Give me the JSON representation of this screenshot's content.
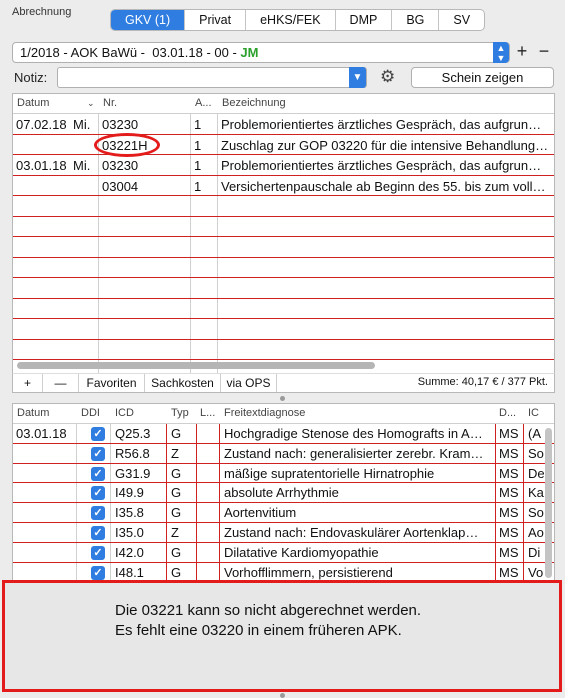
{
  "section_label": "Abrechnung",
  "tabs": [
    "GKV (1)",
    "Privat",
    "eHKS/FEK",
    "DMP",
    "BG",
    "SV"
  ],
  "selector": {
    "text": "1/2018 - AOK BaWü -  03.01.18 - 00 - ",
    "doctor": "JM"
  },
  "notiz": {
    "label": "Notiz:",
    "value": ""
  },
  "schein_button": "Schein zeigen",
  "services": {
    "headers": [
      "Datum",
      "Nr.",
      "A...",
      "Bezeichnung"
    ],
    "rows": [
      {
        "date": "07.02.18",
        "day": "Mi.",
        "nr": "03230",
        "a": "1",
        "desc": "Problemorientiertes ärztliches Gespräch, das aufgrun…"
      },
      {
        "date": "",
        "day": "",
        "nr": "03221H",
        "a": "1",
        "desc": "Zuschlag zur GOP 03220 für die intensive Behandlung…"
      },
      {
        "date": "03.01.18",
        "day": "Mi.",
        "nr": "03230",
        "a": "1",
        "desc": "Problemorientiertes ärztliches Gespräch, das aufgrun…"
      },
      {
        "date": "",
        "day": "",
        "nr": "03004",
        "a": "1",
        "desc": "Versichertenpauschale ab Beginn des 55. bis zum voll…"
      }
    ],
    "toolbar": {
      "add": "+",
      "remove": "—",
      "favoriten": "Favoriten",
      "sachkosten": "Sachkosten",
      "ops": "via OPS",
      "summe": "Summe: 40,17 € / 377 Pkt."
    }
  },
  "diagnoses": {
    "headers": [
      "Datum",
      "DDI",
      "ICD",
      "Typ",
      "L...",
      "Freitextdiagnose",
      "D...",
      "IC"
    ],
    "rows": [
      {
        "date": "03.01.18",
        "icd": "Q25.3",
        "typ": "G",
        "text": "Hochgradige Stenose des Homografts in A…",
        "d": "MS",
        "ic": "(A"
      },
      {
        "date": "",
        "icd": "R56.8",
        "typ": "Z",
        "text": "Zustand nach: generalisierter zerebr. Kram…",
        "d": "MS",
        "ic": "So"
      },
      {
        "date": "",
        "icd": "G31.9",
        "typ": "G",
        "text": "mäßige supratentorielle Hirnatrophie",
        "d": "MS",
        "ic": "De"
      },
      {
        "date": "",
        "icd": "I49.9",
        "typ": "G",
        "text": "absolute Arrhythmie",
        "d": "MS",
        "ic": "Ka"
      },
      {
        "date": "",
        "icd": "I35.8",
        "typ": "G",
        "text": "Aortenvitium",
        "d": "MS",
        "ic": "So"
      },
      {
        "date": "",
        "icd": "I35.0",
        "typ": "Z",
        "text": "Zustand nach: Endovaskulärer Aortenklap…",
        "d": "MS",
        "ic": "Ao"
      },
      {
        "date": "",
        "icd": "I42.0",
        "typ": "G",
        "text": "Dilatative Kardiomyopathie",
        "d": "MS",
        "ic": "Di"
      },
      {
        "date": "",
        "icd": "I48.1",
        "typ": "G",
        "text": "Vorhofflimmern, persistierend",
        "d": "MS",
        "ic": "Vo"
      }
    ]
  },
  "callout": {
    "line1": "Die 03221 kann so nicht abgerechnet werden.",
    "line2": "Es fehlt eine 03220 in einem früheren APK."
  },
  "colors": {
    "accent": "#2f7de1",
    "annotation": "#e41b1b",
    "doctor": "#2ba02b"
  }
}
